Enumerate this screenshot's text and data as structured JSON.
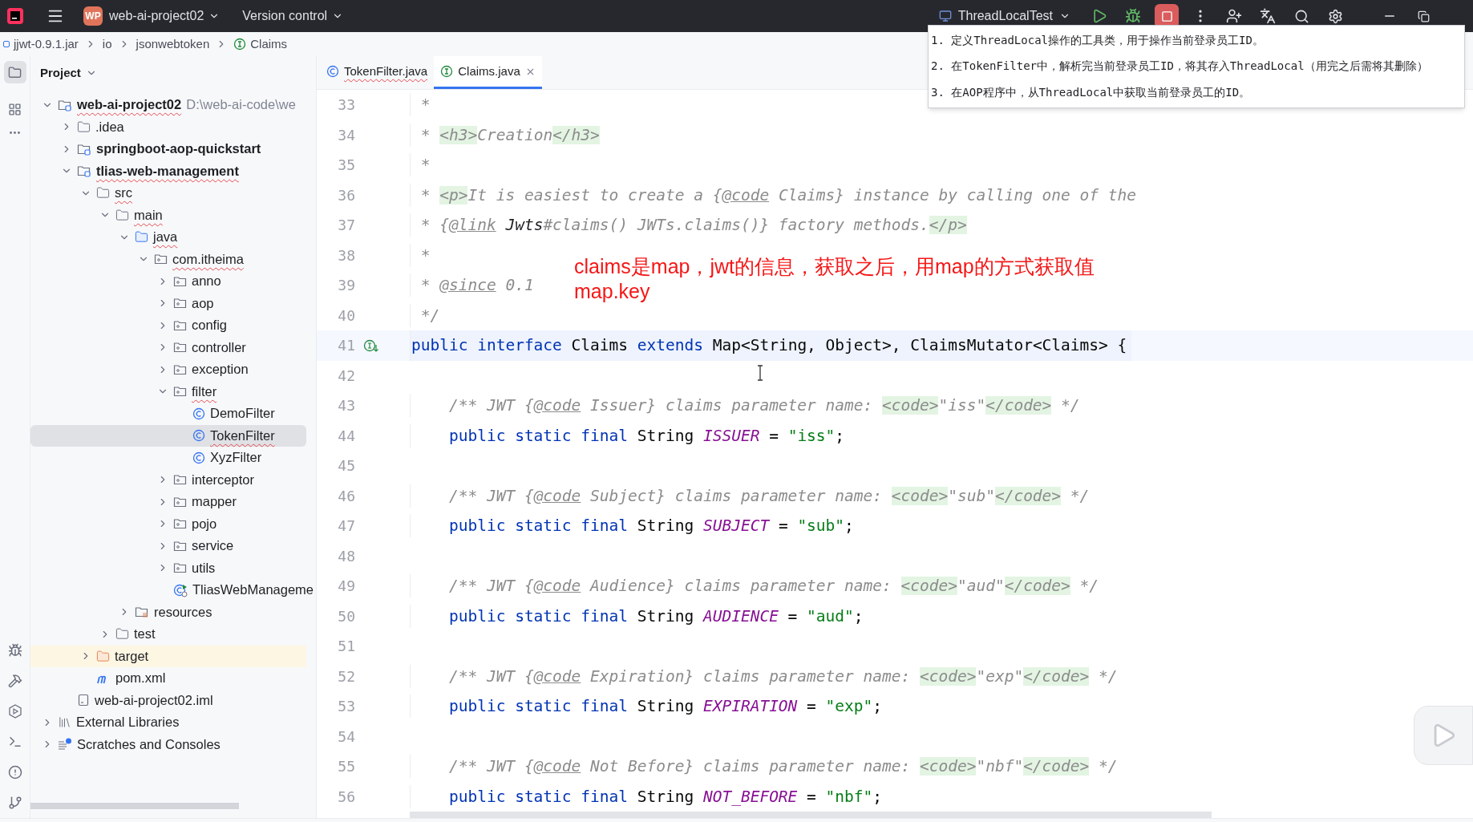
{
  "title_bar": {
    "project_badge": "WP",
    "project_name": "web-ai-project02",
    "vcs": "Version control",
    "run_config": "ThreadLocalTest"
  },
  "breadcrumbs": [
    {
      "label": "jjwt-0.9.1.jar",
      "kind": "jar"
    },
    {
      "label": "io",
      "kind": "plain"
    },
    {
      "label": "jsonwebtoken",
      "kind": "plain"
    },
    {
      "label": "Claims",
      "kind": "interface"
    }
  ],
  "project_panel": {
    "title": "Project",
    "tree": [
      {
        "name": "web-ai-project02",
        "path": "D:\\web-ai-code\\we",
        "kind": "module",
        "bold": true,
        "squiggle": true,
        "selected": false,
        "expanded": true,
        "children": [
          {
            "name": ".idea",
            "kind": "folder",
            "bold": false,
            "squiggle": false,
            "selected": false,
            "expanded": false
          },
          {
            "name": "springboot-aop-quickstart",
            "kind": "module",
            "bold": true,
            "squiggle": false,
            "selected": false,
            "expanded": false
          },
          {
            "name": "tlias-web-management",
            "kind": "module",
            "bold": true,
            "squiggle": true,
            "selected": false,
            "expanded": true,
            "children": [
              {
                "name": "src",
                "kind": "folder",
                "bold": false,
                "squiggle": true,
                "selected": false,
                "expanded": true,
                "children": [
                  {
                    "name": "main",
                    "kind": "folder",
                    "bold": false,
                    "squiggle": true,
                    "selected": false,
                    "expanded": true,
                    "children": [
                      {
                        "name": "java",
                        "kind": "source",
                        "bold": false,
                        "squiggle": true,
                        "selected": false,
                        "expanded": true,
                        "children": [
                          {
                            "name": "com.itheima",
                            "kind": "package",
                            "bold": false,
                            "squiggle": true,
                            "selected": false,
                            "expanded": true,
                            "children": [
                              {
                                "name": "anno",
                                "kind": "package",
                                "bold": false,
                                "squiggle": false,
                                "selected": false,
                                "expanded": false
                              },
                              {
                                "name": "aop",
                                "kind": "package",
                                "bold": false,
                                "squiggle": false,
                                "selected": false,
                                "expanded": false
                              },
                              {
                                "name": "config",
                                "kind": "package",
                                "bold": false,
                                "squiggle": false,
                                "selected": false,
                                "expanded": false
                              },
                              {
                                "name": "controller",
                                "kind": "package",
                                "bold": false,
                                "squiggle": false,
                                "selected": false,
                                "expanded": false
                              },
                              {
                                "name": "exception",
                                "kind": "package",
                                "bold": false,
                                "squiggle": false,
                                "selected": false,
                                "expanded": false
                              },
                              {
                                "name": "filter",
                                "kind": "package",
                                "bold": false,
                                "squiggle": true,
                                "selected": false,
                                "expanded": true,
                                "children": [
                                  {
                                    "name": "DemoFilter",
                                    "kind": "class",
                                    "bold": false,
                                    "squiggle": false,
                                    "selected": false
                                  },
                                  {
                                    "name": "TokenFilter",
                                    "kind": "class",
                                    "bold": false,
                                    "squiggle": true,
                                    "selected": true
                                  },
                                  {
                                    "name": "XyzFilter",
                                    "kind": "class",
                                    "bold": false,
                                    "squiggle": false,
                                    "selected": false
                                  }
                                ]
                              },
                              {
                                "name": "interceptor",
                                "kind": "package",
                                "bold": false,
                                "squiggle": false,
                                "selected": false,
                                "expanded": false
                              },
                              {
                                "name": "mapper",
                                "kind": "package",
                                "bold": false,
                                "squiggle": false,
                                "selected": false,
                                "expanded": false
                              },
                              {
                                "name": "pojo",
                                "kind": "package",
                                "bold": false,
                                "squiggle": false,
                                "selected": false,
                                "expanded": false
                              },
                              {
                                "name": "service",
                                "kind": "package",
                                "bold": false,
                                "squiggle": false,
                                "selected": false,
                                "expanded": false
                              },
                              {
                                "name": "utils",
                                "kind": "package",
                                "bold": false,
                                "squiggle": false,
                                "selected": false,
                                "expanded": false
                              },
                              {
                                "name": "TliasWebManageme",
                                "kind": "app",
                                "bold": false,
                                "squiggle": false,
                                "selected": false
                              }
                            ]
                          }
                        ]
                      },
                      {
                        "name": "resources",
                        "kind": "resources",
                        "bold": false,
                        "squiggle": false,
                        "selected": false,
                        "expanded": false
                      }
                    ]
                  },
                  {
                    "name": "test",
                    "kind": "folder",
                    "bold": false,
                    "squiggle": false,
                    "selected": false,
                    "expanded": false
                  }
                ]
              },
              {
                "name": "target",
                "kind": "excluded",
                "bold": false,
                "squiggle": false,
                "selected": false,
                "expanded": false
              },
              {
                "name": "pom.xml",
                "kind": "pom",
                "bold": false,
                "squiggle": false,
                "selected": false
              }
            ]
          },
          {
            "name": "web-ai-project02.iml",
            "kind": "file",
            "bold": false,
            "squiggle": false,
            "selected": false
          }
        ]
      },
      {
        "name": "External Libraries",
        "kind": "libraries",
        "bold": false,
        "squiggle": false,
        "selected": false,
        "expanded": false
      },
      {
        "name": "Scratches and Consoles",
        "kind": "scratches",
        "bold": false,
        "squiggle": false,
        "selected": false,
        "expanded": false
      }
    ]
  },
  "tabs": [
    {
      "label": "TokenFilter.java",
      "kind": "class",
      "squiggle": true,
      "selected": false
    },
    {
      "label": "Claims.java",
      "kind": "interface",
      "squiggle": false,
      "selected": true
    }
  ],
  "editor": {
    "lines": [
      {
        "number": "33",
        "segments": [
          {
            "text": " *",
            "kind": "comment"
          }
        ]
      },
      {
        "number": "34",
        "segments": [
          {
            "text": " * ",
            "kind": "comment"
          },
          {
            "text": "<h3>",
            "kind": "tag"
          },
          {
            "text": "Creation",
            "kind": "comment"
          },
          {
            "text": "</h3>",
            "kind": "tag"
          }
        ]
      },
      {
        "number": "35",
        "segments": [
          {
            "text": " *",
            "kind": "comment"
          }
        ]
      },
      {
        "number": "36",
        "segments": [
          {
            "text": " * ",
            "kind": "comment"
          },
          {
            "text": "<p>",
            "kind": "tag"
          },
          {
            "text": "It is easiest to create a {",
            "kind": "comment"
          },
          {
            "text": "@code",
            "kind": "doc"
          },
          {
            "text": " Claims} instance by calling one of the",
            "kind": "comment"
          }
        ]
      },
      {
        "number": "37",
        "segments": [
          {
            "text": " * {",
            "kind": "comment"
          },
          {
            "text": "@link",
            "kind": "doc"
          },
          {
            "text": " Jwts",
            "kind": "ref"
          },
          {
            "text": "#claims() JWTs.claims()} factory methods.",
            "kind": "comment"
          },
          {
            "text": "</p>",
            "kind": "tag"
          }
        ]
      },
      {
        "number": "38",
        "segments": [
          {
            "text": " *",
            "kind": "comment"
          }
        ]
      },
      {
        "number": "39",
        "segments": [
          {
            "text": " * ",
            "kind": "comment"
          },
          {
            "text": "@since",
            "kind": "doc"
          },
          {
            "text": " 0.1",
            "kind": "comment"
          }
        ]
      },
      {
        "number": "40",
        "segments": [
          {
            "text": " */",
            "kind": "comment"
          }
        ]
      },
      {
        "number": "41",
        "current": true,
        "segments": [
          {
            "text": "public interface ",
            "kind": "keyword"
          },
          {
            "text": "Claims",
            "kind": "plain"
          },
          {
            "text": " extends ",
            "kind": "keyword"
          },
          {
            "text": "Map<String, Object>, ClaimsMutator<Claims> {",
            "kind": "plain"
          }
        ]
      },
      {
        "number": "42"
      },
      {
        "number": "43",
        "segments": [
          {
            "text": "    /** JWT {",
            "kind": "comment"
          },
          {
            "text": "@code",
            "kind": "doc"
          },
          {
            "text": " Issuer} claims parameter name: ",
            "kind": "comment"
          },
          {
            "text": "<code>",
            "kind": "tag"
          },
          {
            "text": "\"iss\"",
            "kind": "comment"
          },
          {
            "text": "</code>",
            "kind": "tag"
          },
          {
            "text": " */",
            "kind": "comment"
          }
        ]
      },
      {
        "number": "44",
        "segments": [
          {
            "text": "    public static final ",
            "kind": "keyword"
          },
          {
            "text": "String ",
            "kind": "plain"
          },
          {
            "text": "ISSUER",
            "kind": "const"
          },
          {
            "text": " = ",
            "kind": "plain"
          },
          {
            "text": "\"iss\"",
            "kind": "string"
          },
          {
            "text": ";",
            "kind": "plain"
          }
        ]
      },
      {
        "number": "45"
      },
      {
        "number": "46",
        "segments": [
          {
            "text": "    /** JWT {",
            "kind": "comment"
          },
          {
            "text": "@code",
            "kind": "doc"
          },
          {
            "text": " Subject} claims parameter name: ",
            "kind": "comment"
          },
          {
            "text": "<code>",
            "kind": "tag"
          },
          {
            "text": "\"sub\"",
            "kind": "comment"
          },
          {
            "text": "</code>",
            "kind": "tag"
          },
          {
            "text": " */",
            "kind": "comment"
          }
        ]
      },
      {
        "number": "47",
        "segments": [
          {
            "text": "    public static final ",
            "kind": "keyword"
          },
          {
            "text": "String ",
            "kind": "plain"
          },
          {
            "text": "SUBJECT",
            "kind": "const"
          },
          {
            "text": " = ",
            "kind": "plain"
          },
          {
            "text": "\"sub\"",
            "kind": "string"
          },
          {
            "text": ";",
            "kind": "plain"
          }
        ]
      },
      {
        "number": "48"
      },
      {
        "number": "49",
        "segments": [
          {
            "text": "    /** JWT {",
            "kind": "comment"
          },
          {
            "text": "@code",
            "kind": "doc"
          },
          {
            "text": " Audience} claims parameter name: ",
            "kind": "comment"
          },
          {
            "text": "<code>",
            "kind": "tag"
          },
          {
            "text": "\"aud\"",
            "kind": "comment"
          },
          {
            "text": "</code>",
            "kind": "tag"
          },
          {
            "text": " */",
            "kind": "comment"
          }
        ]
      },
      {
        "number": "50",
        "segments": [
          {
            "text": "    public static final ",
            "kind": "keyword"
          },
          {
            "text": "String ",
            "kind": "plain"
          },
          {
            "text": "AUDIENCE",
            "kind": "const"
          },
          {
            "text": " = ",
            "kind": "plain"
          },
          {
            "text": "\"aud\"",
            "kind": "string"
          },
          {
            "text": ";",
            "kind": "plain"
          }
        ]
      },
      {
        "number": "51"
      },
      {
        "number": "52",
        "segments": [
          {
            "text": "    /** JWT {",
            "kind": "comment"
          },
          {
            "text": "@code",
            "kind": "doc"
          },
          {
            "text": " Expiration} claims parameter name: ",
            "kind": "comment"
          },
          {
            "text": "<code>",
            "kind": "tag"
          },
          {
            "text": "\"exp\"",
            "kind": "comment"
          },
          {
            "text": "</code>",
            "kind": "tag"
          },
          {
            "text": " */",
            "kind": "comment"
          }
        ]
      },
      {
        "number": "53",
        "segments": [
          {
            "text": "    public static final ",
            "kind": "keyword"
          },
          {
            "text": "String ",
            "kind": "plain"
          },
          {
            "text": "EXPIRATION",
            "kind": "const"
          },
          {
            "text": " = ",
            "kind": "plain"
          },
          {
            "text": "\"exp\"",
            "kind": "string"
          },
          {
            "text": ";",
            "kind": "plain"
          }
        ]
      },
      {
        "number": "54"
      },
      {
        "number": "55",
        "segments": [
          {
            "text": "    /** JWT {",
            "kind": "comment"
          },
          {
            "text": "@code",
            "kind": "doc"
          },
          {
            "text": " Not Before} claims parameter name: ",
            "kind": "comment"
          },
          {
            "text": "<code>",
            "kind": "tag"
          },
          {
            "text": "\"nbf\"",
            "kind": "comment"
          },
          {
            "text": "</code>",
            "kind": "tag"
          },
          {
            "text": " */",
            "kind": "comment"
          }
        ]
      },
      {
        "number": "56",
        "segments": [
          {
            "text": "    public static final ",
            "kind": "keyword"
          },
          {
            "text": "String ",
            "kind": "plain"
          },
          {
            "text": "NOT_BEFORE",
            "kind": "const"
          },
          {
            "text": " = ",
            "kind": "plain"
          },
          {
            "text": "\"nbf\"",
            "kind": "string"
          },
          {
            "text": ";",
            "kind": "plain"
          }
        ]
      }
    ],
    "annotation": [
      "claims是map，jwt的信息，获取之后，用map的方式获取值",
      "map.key"
    ]
  },
  "note_popup": [
    "1. 定义ThreadLocal操作的工具类，用于操作当前登录员工ID。",
    "2. 在TokenFilter中，解析完当前登录员工ID，将其存入ThreadLocal（用完之后需将其删除）",
    "3. 在AOP程序中，从ThreadLocal中获取当前登录员工的ID。"
  ]
}
